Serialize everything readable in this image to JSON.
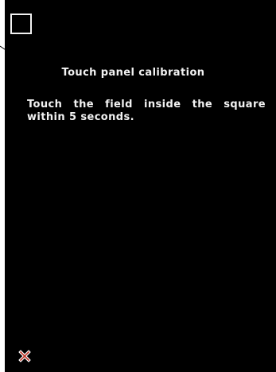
{
  "screen": {
    "calibration_target": "calibration-square",
    "title": "Touch panel calibration",
    "instruction": "Touch the field inside the square within 5 seconds.",
    "close_icon": "close-x-icon"
  },
  "colors": {
    "background": "#000000",
    "text": "#f2f2f2",
    "close_icon_fill": "#c0392b",
    "close_icon_outline": "#ffffff"
  }
}
